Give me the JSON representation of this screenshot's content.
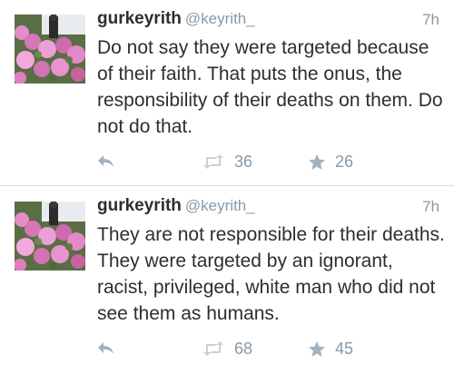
{
  "tweets": [
    {
      "display_name": "gurkeyrith",
      "handle": "@keyrith_",
      "time": "7h",
      "text": "Do not say they were targeted because of their faith. That puts the onus, the responsibility of their deaths on them. Do not do that.",
      "retweets": "36",
      "favorites": "26"
    },
    {
      "display_name": "gurkeyrith",
      "handle": "@keyrith_",
      "time": "7h",
      "text": "They are not responsible for their deaths. They were targeted by an ignorant, racist, privileged, white man who did not see them as humans.",
      "retweets": "68",
      "favorites": "45"
    }
  ],
  "icons": {
    "reply": "reply-icon",
    "retweet": "retweet-icon",
    "favorite": "star-icon"
  },
  "colors": {
    "text": "#292f33",
    "muted": "#8899a6",
    "icon": "#a5b2bd",
    "divider": "#d8dde2"
  }
}
